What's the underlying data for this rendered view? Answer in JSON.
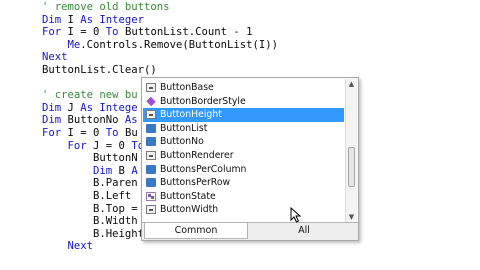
{
  "code_lines": [
    [
      {
        "t": "' remove old buttons",
        "c": "cm"
      }
    ],
    [
      {
        "t": "Dim",
        "c": "kw"
      },
      {
        "t": " I ",
        "c": ""
      },
      {
        "t": "As Integer",
        "c": "kw"
      }
    ],
    [
      {
        "t": "For",
        "c": "kw"
      },
      {
        "t": " I = 0 ",
        "c": ""
      },
      {
        "t": "To",
        "c": "kw"
      },
      {
        "t": " ButtonList.Count - 1",
        "c": ""
      }
    ],
    [
      {
        "t": "    Me",
        "c": "kw"
      },
      {
        "t": ".Controls.Remove(ButtonList(I))",
        "c": ""
      }
    ],
    [
      {
        "t": "Next",
        "c": "kw"
      }
    ],
    [
      {
        "t": "ButtonList.Clear()",
        "c": ""
      }
    ],
    [],
    [
      {
        "t": "' create new bu",
        "c": "cm"
      }
    ],
    [
      {
        "t": "Dim",
        "c": "kw"
      },
      {
        "t": " J ",
        "c": ""
      },
      {
        "t": "As Intege",
        "c": "kw"
      }
    ],
    [
      {
        "t": "Dim",
        "c": "kw"
      },
      {
        "t": " ButtonNo ",
        "c": ""
      },
      {
        "t": "As",
        "c": "kw"
      }
    ],
    [
      {
        "t": "For",
        "c": "kw"
      },
      {
        "t": " I = 0 ",
        "c": ""
      },
      {
        "t": "To",
        "c": "kw"
      },
      {
        "t": " Bu",
        "c": ""
      }
    ],
    [
      {
        "t": "    For",
        "c": "kw"
      },
      {
        "t": " J = 0 ",
        "c": ""
      },
      {
        "t": "To",
        "c": "kw"
      }
    ],
    [
      {
        "t": "        ButtonN",
        "c": ""
      }
    ],
    [
      {
        "t": "        Dim",
        "c": "kw"
      },
      {
        "t": " B ",
        "c": ""
      },
      {
        "t": "A",
        "c": "kw"
      }
    ],
    [
      {
        "t": "        B.Paren",
        "c": ""
      }
    ],
    [
      {
        "t": "        B.Left",
        "c": ""
      }
    ],
    [
      {
        "t": "        B.Top =",
        "c": ""
      }
    ],
    [
      {
        "t": "        B.Width",
        "c": ""
      }
    ],
    [
      {
        "t": "        B.Height =butt",
        "c": "",
        "caret": true
      }
    ],
    [
      {
        "t": "    Next",
        "c": "kw"
      }
    ]
  ],
  "autocomplete": {
    "items": [
      {
        "label": "ButtonBase",
        "icon": "property-icon"
      },
      {
        "label": "ButtonBorderStyle",
        "icon": "method-icon"
      },
      {
        "label": "ButtonHeight",
        "icon": "property-icon",
        "selected": true
      },
      {
        "label": "ButtonList",
        "icon": "field-icon"
      },
      {
        "label": "ButtonNo",
        "icon": "field-icon"
      },
      {
        "label": "ButtonRenderer",
        "icon": "property-icon"
      },
      {
        "label": "ButtonsPerColumn",
        "icon": "field-icon"
      },
      {
        "label": "ButtonsPerRow",
        "icon": "field-icon"
      },
      {
        "label": "ButtonState",
        "icon": "struct-icon"
      },
      {
        "label": "ButtonWidth",
        "icon": "property-icon"
      }
    ],
    "tabs": {
      "common": "Common",
      "all": "All"
    },
    "active_tab": "Common"
  },
  "colors": {
    "keyword": "#1515c8",
    "comment": "#3a8a3a",
    "selection": "#3399ff"
  }
}
